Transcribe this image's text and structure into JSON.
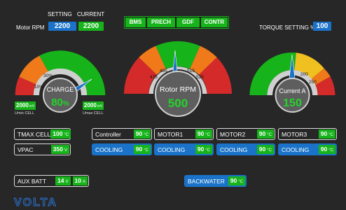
{
  "header": {
    "setting_label": "SETTING",
    "current_label": "CURRENT",
    "motor_rpm_label": "Motor RPM",
    "rpm_setting": "2200",
    "rpm_current": "2200",
    "torque_label": "TORQUE SETTING %",
    "torque_value": "100"
  },
  "top_buttons": [
    "BMS",
    "PRECH",
    "GDF",
    "CONTR"
  ],
  "gauges": {
    "charge": {
      "label": "CHARGE",
      "value": "80",
      "unit": "%",
      "ticks": [
        "10%",
        "30%"
      ],
      "value_fraction": 0.8,
      "cell_min": "2000",
      "cell_max": "2000",
      "cell_unit": "mV",
      "cell_min_label": "Umin CELL",
      "cell_max_label": "Umax CELL"
    },
    "rpm": {
      "label": "Rotor RPM",
      "value": "500",
      "ticks": [
        "475",
        "485",
        "515",
        "525"
      ],
      "value_fraction": 0.5
    },
    "current": {
      "label": "Current A",
      "value": "150",
      "ticks": [
        "200",
        "250"
      ],
      "value_fraction": 0.5
    }
  },
  "readouts": {
    "tmax_cell": {
      "label": "TMAX CELL",
      "value": "100",
      "unit": "°C"
    },
    "vpac": {
      "label": "VPAC",
      "value": "350",
      "unit": "V"
    },
    "controller": {
      "label": "Controller",
      "value": "90",
      "unit": "°C"
    },
    "motor1": {
      "label": "MOTOR1",
      "value": "90",
      "unit": "°C"
    },
    "motor2": {
      "label": "MOTOR2",
      "value": "90",
      "unit": "°C"
    },
    "motor3": {
      "label": "MOTOR3",
      "value": "90",
      "unit": "°C"
    },
    "cooling1": {
      "label": "COOLING",
      "value": "90",
      "unit": "°C"
    },
    "cooling2": {
      "label": "COOLING",
      "value": "90",
      "unit": "°C"
    },
    "cooling3": {
      "label": "COOLING",
      "value": "90",
      "unit": "°C"
    },
    "cooling4": {
      "label": "COOLING",
      "value": "90",
      "unit": "°C"
    },
    "aux_batt": {
      "label": "AUX BATT",
      "voltage": "14",
      "voltage_unit": "V",
      "current": "10",
      "current_unit": "A"
    },
    "backwater": {
      "label": "BACKWATER",
      "value": "90",
      "unit": "°C"
    }
  },
  "logo": "VOLTA",
  "colors": {
    "background": "#272727",
    "green": "#16b41a",
    "blue": "#1a73c8",
    "red": "#d42a2a",
    "orange": "#f07a1a",
    "yellow": "#f0c020",
    "needle": "#1a73c8"
  }
}
